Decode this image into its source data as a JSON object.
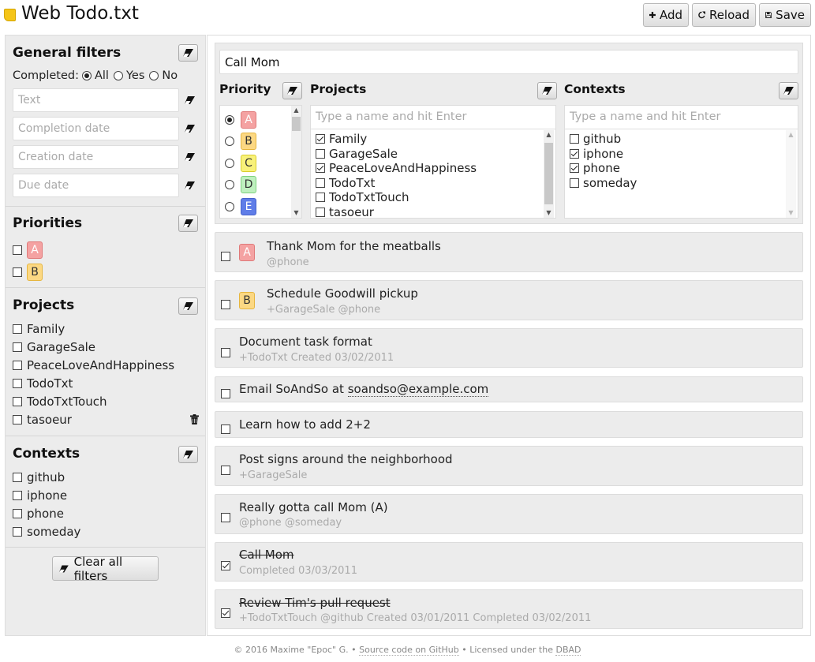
{
  "header": {
    "title": "Web Todo.txt",
    "add_label": "Add",
    "reload_label": "Reload",
    "save_label": "Save",
    "colors": {
      "logo": "#f5c518"
    }
  },
  "sidebar": {
    "general_filters": {
      "title": "General filters",
      "completed_label": "Completed:",
      "options": [
        "All",
        "Yes",
        "No"
      ],
      "selected": "All",
      "text_placeholder": "Text",
      "completion_date_placeholder": "Completion date",
      "creation_date_placeholder": "Creation date",
      "due_date_placeholder": "Due date"
    },
    "priorities": {
      "title": "Priorities",
      "items": [
        "A",
        "B"
      ]
    },
    "projects": {
      "title": "Projects",
      "items": [
        "Family",
        "GarageSale",
        "PeaceLoveAndHappiness",
        "TodoTxt",
        "TodoTxtTouch",
        "tasoeur"
      ]
    },
    "contexts": {
      "title": "Contexts",
      "items": [
        "github",
        "iphone",
        "phone",
        "someday"
      ]
    },
    "clear_all_label": "Clear all filters"
  },
  "editor": {
    "task_text": "Call Mom",
    "priority": {
      "title": "Priority",
      "items": [
        "A",
        "B",
        "C",
        "D",
        "E"
      ],
      "selected": "A"
    },
    "projects": {
      "title": "Projects",
      "placeholder": "Type a name and hit Enter",
      "items": [
        {
          "label": "Family",
          "checked": true
        },
        {
          "label": "GarageSale",
          "checked": false
        },
        {
          "label": "PeaceLoveAndHappiness",
          "checked": true
        },
        {
          "label": "TodoTxt",
          "checked": false
        },
        {
          "label": "TodoTxtTouch",
          "checked": false
        },
        {
          "label": "tasoeur",
          "checked": false
        }
      ]
    },
    "contexts": {
      "title": "Contexts",
      "placeholder": "Type a name and hit Enter",
      "items": [
        {
          "label": "github",
          "checked": false
        },
        {
          "label": "iphone",
          "checked": true
        },
        {
          "label": "phone",
          "checked": true
        },
        {
          "label": "someday",
          "checked": false
        }
      ]
    }
  },
  "tasks": [
    {
      "priority": "A",
      "title": "Thank Mom for the meatballs",
      "meta": "@phone",
      "done": false
    },
    {
      "priority": "B",
      "title": "Schedule Goodwill pickup",
      "meta": "+GarageSale @phone",
      "done": false
    },
    {
      "priority": "",
      "title": "Document task format",
      "meta": "+TodoTxt Created 03/02/2011",
      "done": false
    },
    {
      "priority": "",
      "title": "Email SoAndSo at",
      "link": "soandso@example.com",
      "meta": "",
      "done": false
    },
    {
      "priority": "",
      "title": "Learn how to add 2+2",
      "meta": "",
      "done": false
    },
    {
      "priority": "",
      "title": "Post signs around the neighborhood",
      "meta": "+GarageSale",
      "done": false
    },
    {
      "priority": "",
      "title": "Really gotta call Mom (A)",
      "meta": "@phone @someday",
      "done": false
    },
    {
      "priority": "",
      "title": "Call Mom",
      "meta": "Completed 03/03/2011",
      "done": true
    },
    {
      "priority": "",
      "title": "Review Tim's pull request",
      "meta": "+TodoTxtTouch @github Created 03/01/2011 Completed 03/02/2011",
      "done": true
    }
  ],
  "footer": {
    "copyright": "© 2016 Maxime \"Epoc\" G.",
    "source_link": "Source code on GitHub",
    "license_text": "Licensed under the",
    "license_link": "DBAD",
    "sep": "•"
  }
}
